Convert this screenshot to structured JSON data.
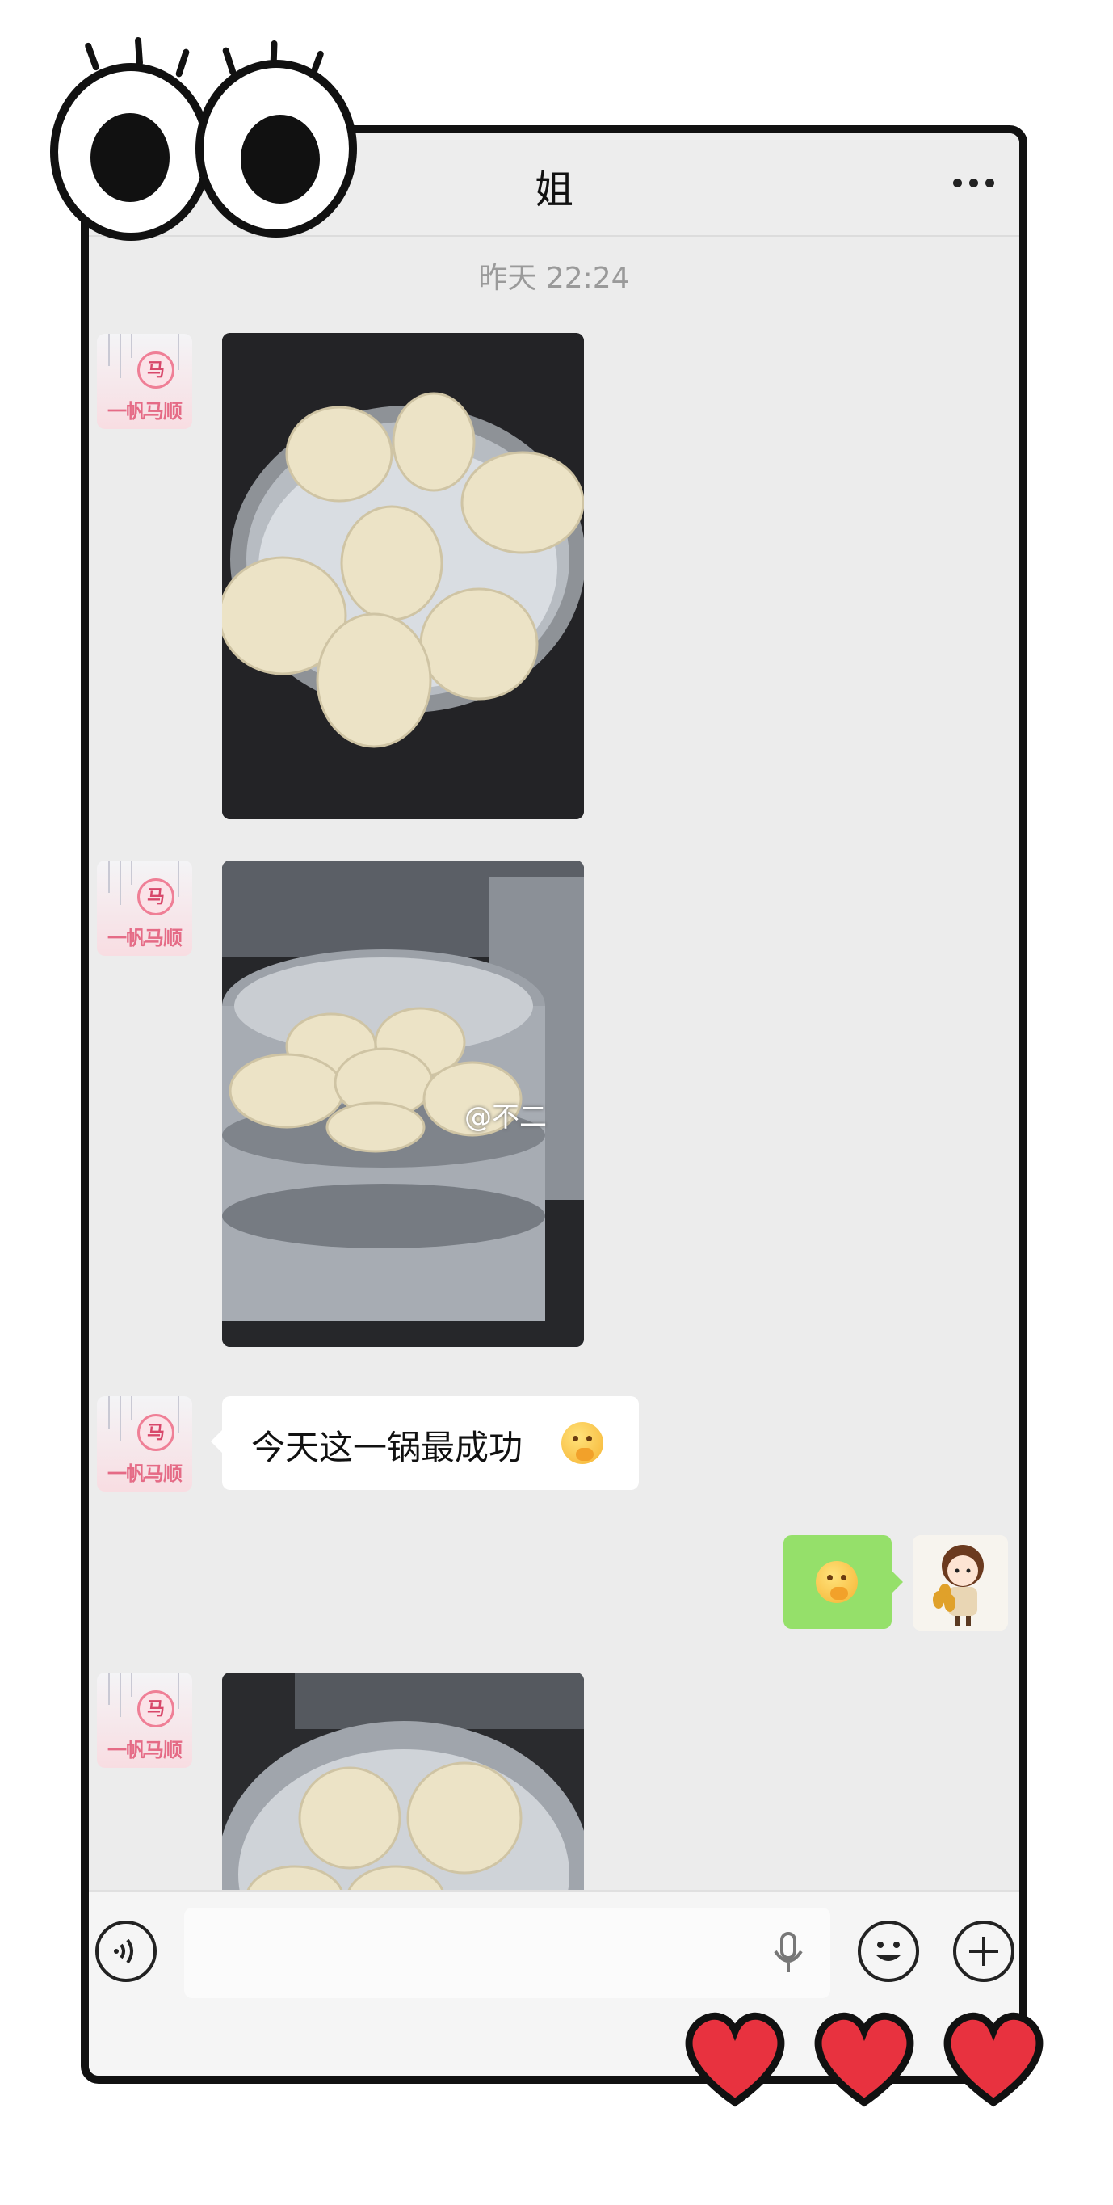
{
  "header": {
    "title": "姐"
  },
  "timestamp": "昨天 22:24",
  "contact_avatar": {
    "text": "一帆马顺",
    "badge": "马"
  },
  "messages": [
    {
      "type": "image",
      "sender": "contact",
      "description_icon": "steamed-buns-photo"
    },
    {
      "type": "image",
      "sender": "contact",
      "watermark": "@不二",
      "description_icon": "steamer-stack-photo"
    },
    {
      "type": "text",
      "sender": "contact",
      "text": "今天这一锅最成功"
    },
    {
      "type": "emoji",
      "sender": "me"
    },
    {
      "type": "image",
      "sender": "contact",
      "description_icon": "steamed-buns-photo"
    }
  ],
  "colors": {
    "chat_bg": "#ececec",
    "my_bubble": "#95e06a",
    "heart": "#e8323f"
  }
}
